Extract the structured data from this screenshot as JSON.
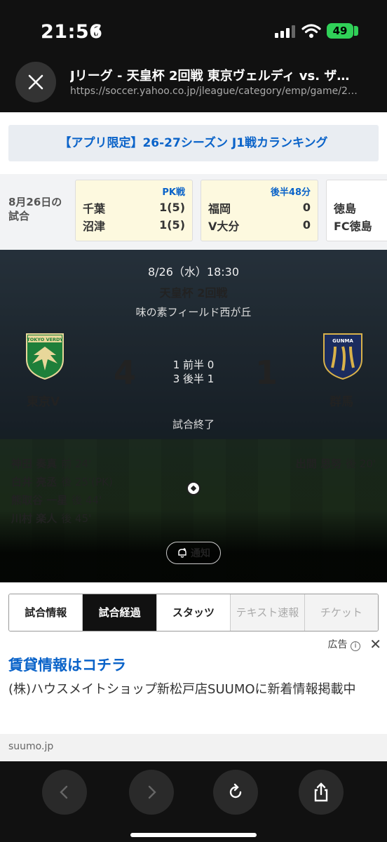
{
  "status_bar": {
    "time": "21:56",
    "battery": "49"
  },
  "browser": {
    "title": "Jリーグ - 天皇杯 2回戦 東京ヴェルディ vs. ザ…",
    "url": "https://soccer.yahoo.co.jp/jleague/category/emp/game/2…"
  },
  "promo": {
    "text": "【アプリ限定】26-27シーズン J1戦カランキング"
  },
  "ticker": {
    "label_line1": "8月26日の",
    "label_line2": "試合",
    "cards": [
      {
        "status": "PK戦",
        "home": "千葉",
        "home_score": "1(5)",
        "away": "沼津",
        "away_score": "1(5)"
      },
      {
        "status": "後半48分",
        "home": "福岡",
        "home_score": "0",
        "away": "V大分",
        "away_score": "0"
      },
      {
        "status": "",
        "home": "徳島",
        "home_score": "",
        "away": "FC徳島",
        "away_score": ""
      }
    ]
  },
  "match": {
    "date": "8/26（水）18:30",
    "competition": "天皇杯 2回戦",
    "venue": "味の素フィールド西が丘",
    "home_team": "東京V",
    "away_team": "群馬",
    "home_score": "4",
    "away_score": "1",
    "first_half": "1 前半 0",
    "second_half": "3 後半 1",
    "status": "試合終了",
    "home_goals": [
      {
        "player": "神田 奏真",
        "time": "前 24'"
      },
      {
        "player": "白井 亮丞",
        "time": "後 25'(PK)"
      },
      {
        "player": "熊取谷 一星",
        "time": "後 44'"
      },
      {
        "player": "川村 楽人",
        "time": "後 45'"
      }
    ],
    "away_goals": [
      {
        "player": "出間 思努",
        "time": "後 20'"
      }
    ],
    "notify_label": "通知",
    "home_crest_text": "TOKYO VERDY",
    "away_crest_text": "GUNMA"
  },
  "tabs": [
    {
      "label": "試合情報",
      "state": "normal"
    },
    {
      "label": "試合経過",
      "state": "active"
    },
    {
      "label": "スタッツ",
      "state": "normal"
    },
    {
      "label": "テキスト速報",
      "state": "disabled"
    },
    {
      "label": "チケット",
      "state": "disabled"
    }
  ],
  "ad": {
    "label": "広告",
    "title": "賃貸情報はコチラ",
    "body": "(株)ハウスメイトショップ新松戸店SUUMOに新着情報掲載中",
    "domain": "suumo.jp"
  },
  "colors": {
    "link_blue": "#0a63c9",
    "battery_green": "#30d158",
    "verdy_green": "#1e7f3a",
    "gunma_navy": "#1b2c5e",
    "gunma_gold": "#d9b24a"
  }
}
